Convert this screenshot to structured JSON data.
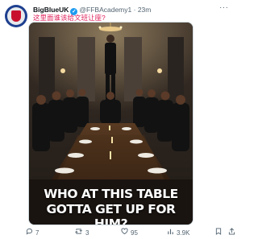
{
  "post": {
    "author_name": "BigBlueUK",
    "verified_mark": "✓",
    "handle": "@FFBAcademy1",
    "separator": "·",
    "time": "23m",
    "more_label": "···",
    "caption": "这里面谁该给文班让座?",
    "headline_line1": "WHO AT THIS TABLE",
    "headline_line2": "GOTTA GET UP FOR HIM?"
  },
  "actions": {
    "reply_count": "7",
    "repost_count": "3",
    "like_count": "95",
    "views_count": "3.9K"
  },
  "icons": {
    "reply": "speech-bubble-icon",
    "repost": "repost-arrows-icon",
    "like": "heart-icon",
    "views": "bar-chart-icon",
    "bookmark": "bookmark-icon",
    "share": "share-icon"
  },
  "colors": {
    "accent": "#1d9bf0",
    "caption": "#e0245e",
    "muted": "#536471"
  }
}
